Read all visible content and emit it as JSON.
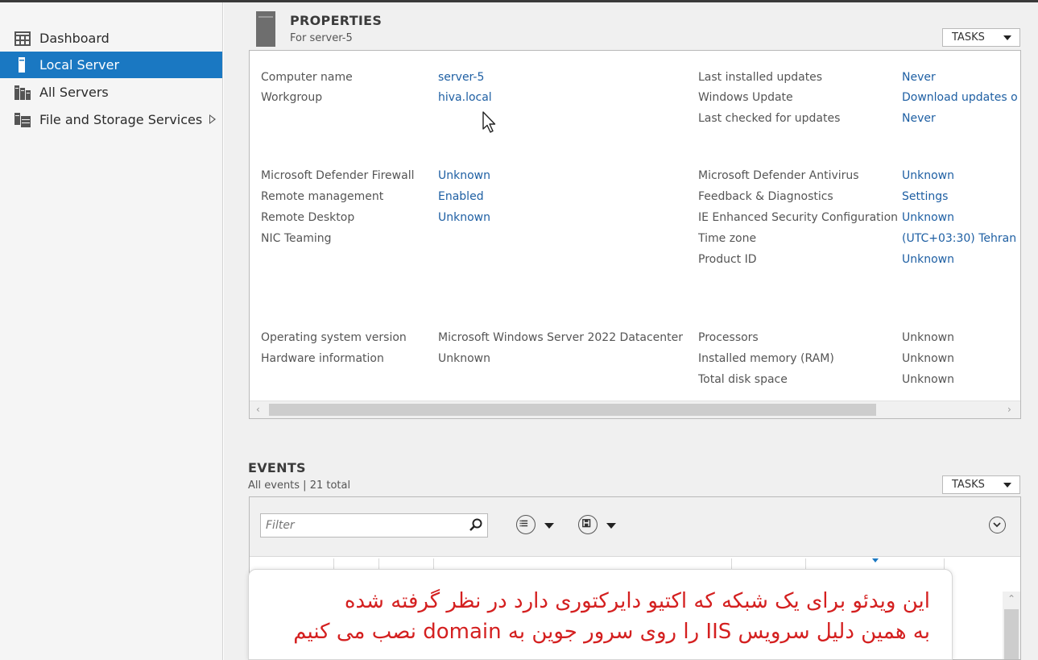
{
  "sidebar": {
    "items": [
      {
        "label": "Dashboard",
        "icon": "dashboard-icon"
      },
      {
        "label": "Local Server",
        "icon": "server-icon",
        "active": true
      },
      {
        "label": "All Servers",
        "icon": "servers-icon"
      },
      {
        "label": "File and Storage Services",
        "icon": "storage-icon"
      }
    ]
  },
  "properties": {
    "title": "PROPERTIES",
    "subtitle": "For server-5",
    "tasks_label": "TASKS",
    "rows": {
      "computer_name": {
        "label": "Computer name",
        "value": "server-5"
      },
      "workgroup": {
        "label": "Workgroup",
        "value": "hiva.local"
      },
      "last_installed": {
        "label": "Last installed updates",
        "value": "Never"
      },
      "windows_update": {
        "label": "Windows Update",
        "value": "Download updates o"
      },
      "last_checked": {
        "label": "Last checked for updates",
        "value": "Never"
      },
      "firewall": {
        "label": "Microsoft Defender Firewall",
        "value": "Unknown"
      },
      "remote_mgmt": {
        "label": "Remote management",
        "value": "Enabled"
      },
      "remote_desktop": {
        "label": "Remote Desktop",
        "value": "Unknown"
      },
      "nic_teaming": {
        "label": "NIC Teaming",
        "value": ""
      },
      "antivirus": {
        "label": "Microsoft Defender Antivirus",
        "value": "Unknown"
      },
      "feedback": {
        "label": "Feedback & Diagnostics",
        "value": "Settings"
      },
      "ie_security": {
        "label": "IE Enhanced Security Configuration",
        "value": "Unknown"
      },
      "time_zone": {
        "label": "Time zone",
        "value": "(UTC+03:30) Tehran"
      },
      "product_id": {
        "label": "Product ID",
        "value": "Unknown"
      },
      "os_version": {
        "label": "Operating system version",
        "value": "Microsoft Windows Server 2022 Datacenter"
      },
      "hardware": {
        "label": "Hardware information",
        "value": "Unknown"
      },
      "processors": {
        "label": "Processors",
        "value": "Unknown"
      },
      "memory": {
        "label": "Installed memory (RAM)",
        "value": "Unknown"
      },
      "disk": {
        "label": "Total disk space",
        "value": "Unknown"
      }
    }
  },
  "events": {
    "title": "EVENTS",
    "subtitle": "All events | 21 total",
    "tasks_label": "TASKS",
    "filter_placeholder": "Filter"
  },
  "caption": {
    "line1": "این ویدئو برای یک شبکه که اکتیو دایرکتوری دارد در نظر گرفته شده",
    "line2": "به همین دلیل سرویس IIS را روی سرور جوین به domain نصب می کنیم"
  },
  "colors": {
    "accent": "#1a78c2",
    "link": "#1e5fa3",
    "caption_text": "#d42020"
  }
}
